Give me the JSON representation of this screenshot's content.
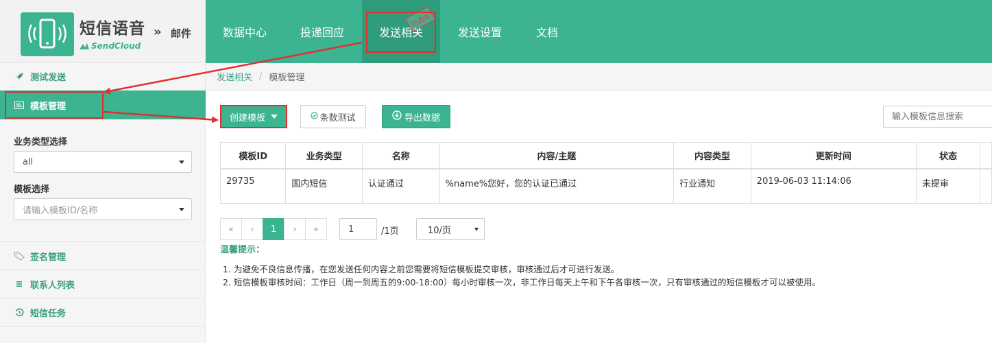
{
  "brand": {
    "title": "短信语音",
    "switch_arrow": "»",
    "switch_label": "邮件",
    "sub": "SendCloud"
  },
  "topnav": {
    "items": [
      {
        "label": "数据中心"
      },
      {
        "label": "投递回应"
      },
      {
        "label": "发送相关"
      },
      {
        "label": "发送设置"
      },
      {
        "label": "文档"
      }
    ],
    "active_index": 2,
    "stamp": "已选中"
  },
  "sidebar": {
    "test_send": "测试发送",
    "template_mgmt": "模板管理",
    "filter_business_label": "业务类型选择",
    "filter_business_value": "all",
    "filter_template_label": "模板选择",
    "filter_template_placeholder": "请输入模板ID/名称",
    "sign_mgmt": "签名管理",
    "contacts": "联系人列表",
    "sms_task": "短信任务"
  },
  "breadcrumb": {
    "parent": "发送相关",
    "separator": "/",
    "current": "模板管理"
  },
  "toolbar": {
    "create_label": "创建模板",
    "count_test_label": "条数测试",
    "export_label": "导出数据",
    "search_placeholder": "输入模板信息搜索"
  },
  "table": {
    "columns": [
      "模板ID",
      "业务类型",
      "名称",
      "内容/主题",
      "内容类型",
      "更新时间",
      "状态"
    ],
    "rows": [
      {
        "id": "29735",
        "business_type": "国内短信",
        "name": "认证通过",
        "content": "%name%您好，您的认证已通过",
        "content_type": "行业通知",
        "updated": "2019-06-03 11:14:06",
        "status": "未提审"
      }
    ]
  },
  "pagination": {
    "first": "«",
    "prev": "‹",
    "current": "1",
    "next": "›",
    "last": "»",
    "page_input": "1",
    "total": "/1页",
    "page_size": "10/页"
  },
  "tips": {
    "title": "温馨提示：",
    "items": [
      "1. 为避免不良信息传播，在您发送任何内容之前您需要将短信模板提交审核，审核通过后才可进行发送。",
      "2. 短信模板审核时间：工作日（周一到周五的9:00-18:00）每小时审核一次，非工作日每天上午和下午各审核一次，只有审核通过的短信模板才可以被使用。"
    ]
  },
  "colors": {
    "brand_green": "#3cb391",
    "active_green": "#2f9c7c",
    "annotation_red": "#e03030"
  },
  "icons": {
    "logo": "phone-signal-icon",
    "test_send": "rocket-icon",
    "template_mgmt": "card-icon",
    "sign_mgmt": "tag-icon",
    "contacts": "list-icon",
    "sms_task": "history-icon",
    "count_test": "check-circle-icon",
    "export": "download-circle-icon"
  }
}
